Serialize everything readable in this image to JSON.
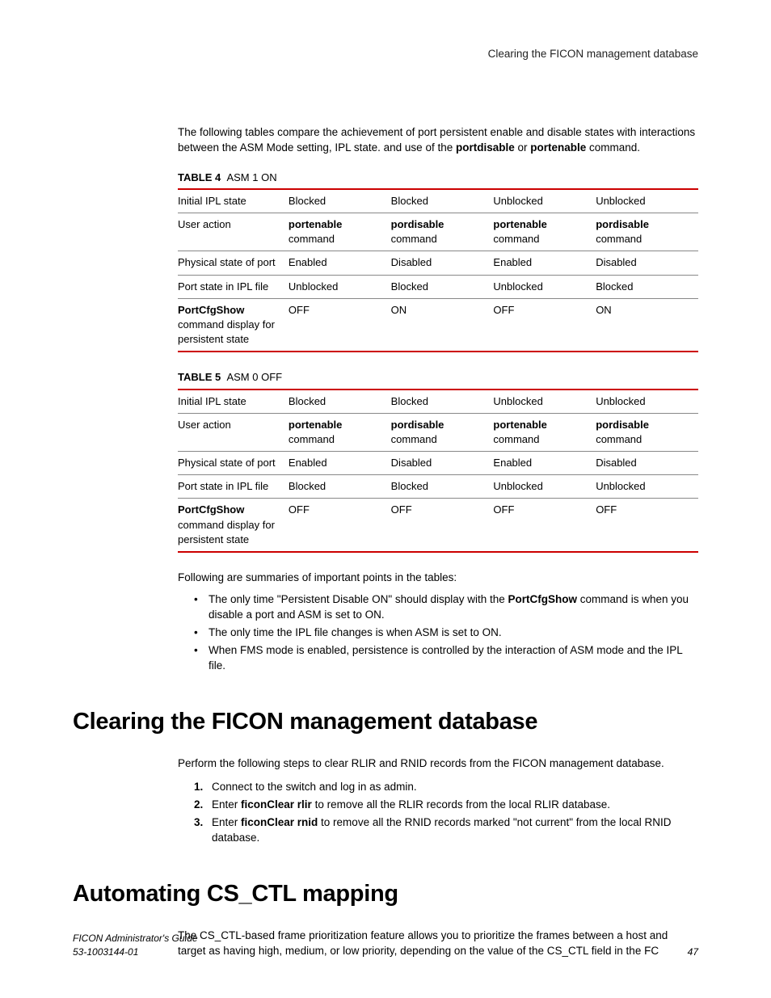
{
  "header": {
    "running": "Clearing the FICON management database"
  },
  "intro": {
    "pre": "The following tables compare the achievement of port persistent enable and disable states with interactions between the ASM Mode setting, IPL state. and use of the ",
    "cmd1": "portdisable",
    "or": " or ",
    "cmd2": "portenable",
    "post": " command."
  },
  "table4": {
    "label": "TABLE 4",
    "title": "ASM 1 ON",
    "rows": [
      {
        "label_plain": "Initial IPL state",
        "c": [
          "Blocked",
          "Blocked",
          "Unblocked",
          "Unblocked"
        ]
      },
      {
        "label_plain": "User action",
        "c_bold": [
          "portenable",
          "pordisable",
          "portenable",
          "pordisable"
        ],
        "c_sub": [
          "command",
          "command",
          "command",
          "command"
        ]
      },
      {
        "label_plain": "Physical state of port",
        "c": [
          "Enabled",
          "Disabled",
          "Enabled",
          "Disabled"
        ]
      },
      {
        "label_plain": "Port state in IPL file",
        "c": [
          "Unblocked",
          "Blocked",
          "Unblocked",
          "Blocked"
        ]
      },
      {
        "label_bold": "PortCfgShow",
        "label_sub": "command display for persistent state",
        "c": [
          "OFF",
          "ON",
          "OFF",
          "ON"
        ]
      }
    ]
  },
  "table5": {
    "label": "TABLE 5",
    "title": "ASM 0 OFF",
    "rows": [
      {
        "label_plain": "Initial IPL state",
        "c": [
          "Blocked",
          "Blocked",
          "Unblocked",
          "Unblocked"
        ]
      },
      {
        "label_plain": "User action",
        "c_bold": [
          "portenable",
          "pordisable",
          "portenable",
          "pordisable"
        ],
        "c_sub": [
          "command",
          "command",
          "command",
          "command"
        ]
      },
      {
        "label_plain": "Physical state of port",
        "c": [
          "Enabled",
          "Disabled",
          "Enabled",
          "Disabled"
        ]
      },
      {
        "label_plain": "Port state in IPL file",
        "c": [
          "Blocked",
          "Blocked",
          "Unblocked",
          "Unblocked"
        ]
      },
      {
        "label_bold": "PortCfgShow",
        "label_sub": "command display for persistent state",
        "c": [
          "OFF",
          "OFF",
          "OFF",
          "OFF"
        ]
      }
    ]
  },
  "summary": {
    "lead": "Following are summaries of important points in the tables:",
    "items": [
      {
        "pre": "The only time \"Persistent Disable ON\" should display with the ",
        "bold": "PortCfgShow",
        "post": " command is when you disable a port and ASM is set to ON."
      },
      {
        "pre": "The only time the IPL file changes is when ASM is set to ON."
      },
      {
        "pre": "When FMS mode is enabled, persistence is controlled by the interaction of ASM mode and the IPL file."
      }
    ]
  },
  "section1": {
    "heading": "Clearing the FICON management database",
    "para": "Perform the following steps to clear RLIR and RNID records from the FICON management database.",
    "steps": [
      {
        "pre": "Connect to the switch and log in as admin."
      },
      {
        "pre": "Enter ",
        "bold": "ficonClear rlir",
        "post": " to remove all the RLIR records from the local RLIR database."
      },
      {
        "pre": "Enter ",
        "bold": "ficonClear rnid",
        "post": " to remove all the RNID records marked \"not current\" from the local RNID database."
      }
    ]
  },
  "section2": {
    "heading": "Automating CS_CTL mapping",
    "para": "The CS_CTL-based frame prioritization feature allows you to prioritize the frames between a host and target as having high, medium, or low priority, depending on the value of the CS_CTL field in the FC"
  },
  "footer": {
    "title": "FICON Administrator's Guide",
    "docnum": "53-1003144-01",
    "page": "47"
  }
}
